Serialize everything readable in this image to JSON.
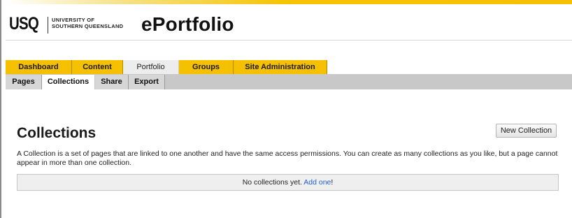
{
  "branding": {
    "logo_mark": "USQ",
    "logo_line1": "UNIVERSITY OF",
    "logo_line2": "SOUTHERN QUEENSLAND",
    "app_title": "ePortfolio"
  },
  "main_nav": {
    "tabs": [
      {
        "label": "Dashboard"
      },
      {
        "label": "Content"
      },
      {
        "label": "Portfolio"
      },
      {
        "label": "Groups"
      },
      {
        "label": "Site Administration"
      }
    ],
    "active": "Portfolio"
  },
  "sub_nav": {
    "tabs": [
      {
        "label": "Pages"
      },
      {
        "label": "Collections"
      },
      {
        "label": "Share"
      },
      {
        "label": "Export"
      }
    ],
    "active": "Collections"
  },
  "main": {
    "heading": "Collections",
    "new_button_label": "New Collection",
    "description": "A Collection is a set of pages that are linked to one another and have the same access permissions. You can create as many collections as you like, but a page cannot appear in more than one collection.",
    "empty_text": "No collections yet.",
    "add_link": "Add one",
    "add_suffix": "!"
  },
  "colors": {
    "accent": "#f5c000",
    "link": "#1f5fd1",
    "subnav_bg": "#c8c8c8"
  }
}
